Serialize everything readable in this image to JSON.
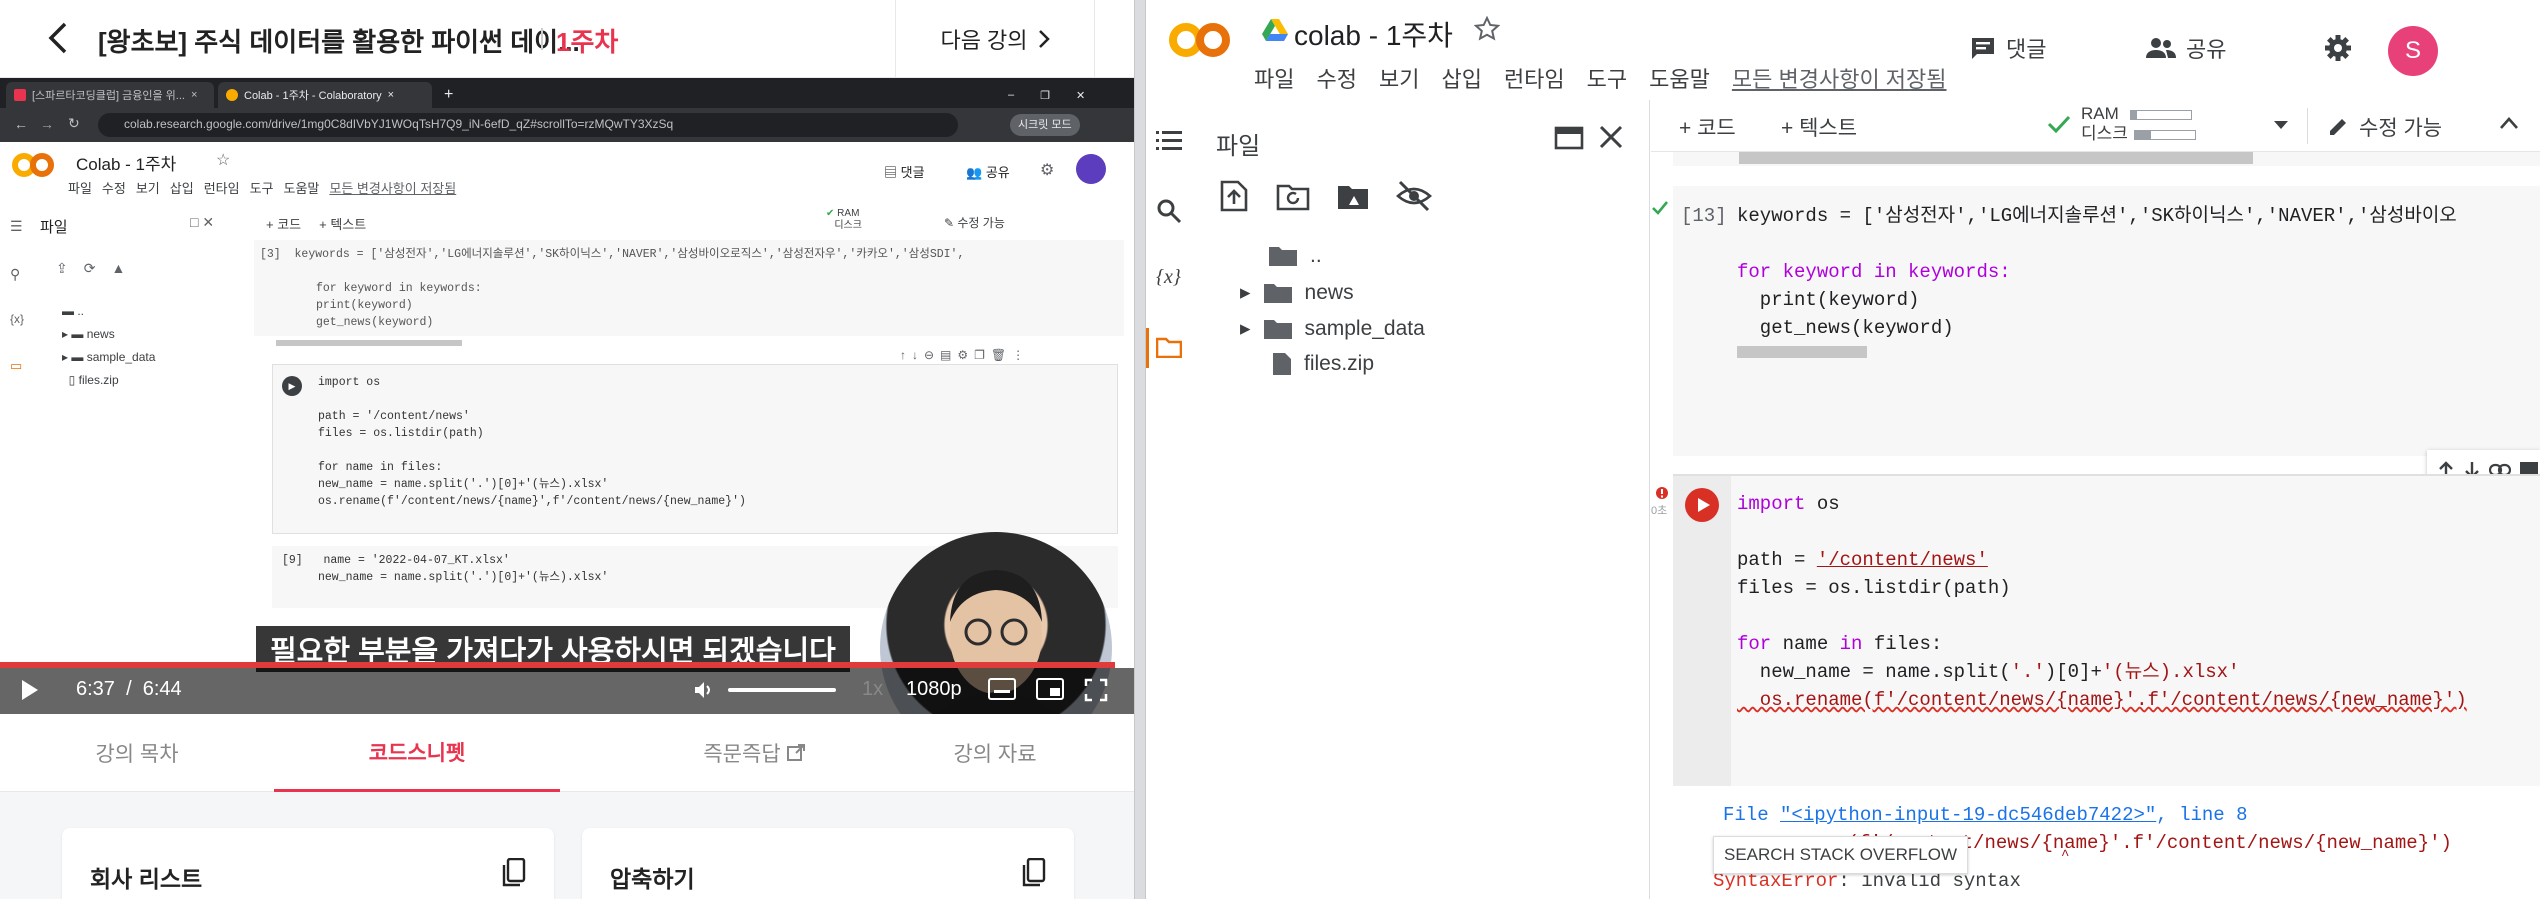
{
  "lecture": {
    "title": "[왕초보] 주식 데이터를 활용한 파이썬 데이...",
    "week": "1주차",
    "next_label": "다음 강의",
    "tabs": [
      {
        "label": "강의 목차"
      },
      {
        "label": "코드스니펫"
      },
      {
        "label": "즉문즉답"
      },
      {
        "label": "강의 자료"
      }
    ],
    "cards": [
      {
        "title": "회사 리스트"
      },
      {
        "title": "압축하기"
      }
    ]
  },
  "video": {
    "browser_tabs": [
      {
        "label": "[스파르타코딩클럽] 금융인을 위..."
      },
      {
        "label": "Colab - 1주차 - Colaboratory"
      }
    ],
    "url": "colab.research.google.com/drive/1mg0C8dIVbYJ1WOqTsH7Q9_iN-6efD_qZ#scrollTo=rzMQwTY3XzSq",
    "incognito_label": "시크릿 모드",
    "mini_colab": {
      "title": "Colab - 1주차",
      "menu": [
        "파일",
        "수정",
        "보기",
        "삽입",
        "런타임",
        "도구",
        "도움말"
      ],
      "saved": "모든 변경사항이 저장됨",
      "comments": "댓글",
      "share": "공유",
      "files_title": "파일",
      "tree": [
        "..",
        "news",
        "sample_data",
        "files.zip"
      ],
      "add_code": "+ 코드",
      "add_text": "+ 텍스트",
      "ram": "RAM",
      "disk": "디스크",
      "edit": "수정 가능",
      "cell1_num": "[3]",
      "cell1_l1": "keywords = ['삼성전자','LG에너지솔루션','SK하이닉스','NAVER','삼성바이오로직스','삼성전자우','카카오','삼성SDI',",
      "cell1_l2": "for keyword in keywords:",
      "cell1_l3": "  print(keyword)",
      "cell1_l4": "  get_news(keyword)",
      "cell2_l1": "import os",
      "cell2_l2": "path = '/content/news'",
      "cell2_l3": "files = os.listdir(path)",
      "cell2_l4": "for name in files:",
      "cell2_l5": "  new_name = name.split('.')[0]+'(뉴스).xlsx'",
      "cell2_l6": "  os.rename(f'/content/news/{name}',f'/content/news/{new_name}')",
      "cell3_num": "[9]",
      "cell3_l1": "name = '2022-04-07_KT.xlsx'",
      "cell3_l2": "new_name = name.split('.')[0]+'(뉴스).xlsx'"
    },
    "subtitle": "필요한 부분을 가져다가 사용하시면 되겠습니다",
    "current_time": "6:37",
    "time_sep": "/",
    "duration": "6:44",
    "progress": 0.983,
    "speed": "1x",
    "quality": "1080p"
  },
  "colab": {
    "title": "colab - 1주차",
    "menu": [
      "파일",
      "수정",
      "보기",
      "삽입",
      "런타임",
      "도구",
      "도움말"
    ],
    "saved": "모든 변경사항이 저장됨",
    "comments": "댓글",
    "share": "공유",
    "avatar": "S",
    "files_title": "파일",
    "tree": [
      {
        "label": ".."
      },
      {
        "label": "news"
      },
      {
        "label": "sample_data"
      },
      {
        "label": "files.zip"
      }
    ],
    "toolbar": {
      "add_code": "+ 코드",
      "add_text": "+ 텍스트",
      "ram": "RAM",
      "disk": "디스크",
      "edit": "수정 가능"
    },
    "cell1": {
      "exec": "[13]",
      "l1": "keywords = ['삼성전자','LG에너지솔루션','SK하이닉스','NAVER','삼성바이오",
      "l2": "for keyword in keywords:",
      "l3": "  print(keyword)",
      "l4": "  get_news(keyword)"
    },
    "cell2": {
      "time": "0초",
      "l1_kw": "import",
      "l1_rest": " os",
      "l2_a": "path = ",
      "l2_str": "'/content/news'",
      "l3": "files = os.listdir(path)",
      "l4_kw": "for",
      "l4_mid": " name ",
      "l4_kw2": "in",
      "l4_rest": " files:",
      "l5_a": "  new_name = name.split(",
      "l5_s1": "'.'",
      "l5_b": ")[0]+",
      "l5_s2": "'(뉴스).xlsx'",
      "l6": "  os.rename(f'/content/news/{name}'.f'/content/news/{new_name}')"
    },
    "output": {
      "file_label": "File ",
      "file_link": "\"<ipython-input-19-dc546deb7422>\"",
      "line_label": ", line 8",
      "code": "os.rename(f'/content/news/{name}'.f'/content/news/{new_name}')",
      "caret": "^",
      "error_name": "SyntaxError",
      "error_msg": ": invalid syntax",
      "so_button": "SEARCH STACK OVERFLOW"
    }
  }
}
